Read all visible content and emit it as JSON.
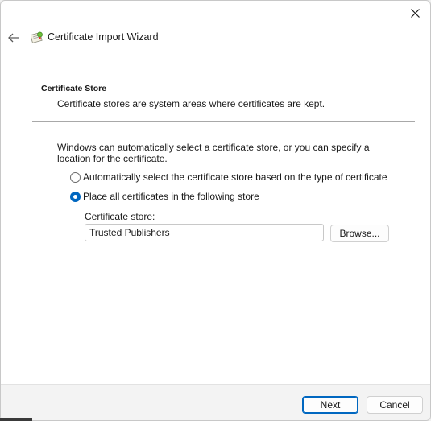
{
  "window": {
    "title": "Certificate Import Wizard",
    "icons": {
      "close": "close-icon",
      "back": "back-arrow-icon",
      "app": "certificate-icon"
    }
  },
  "page": {
    "section_title": "Certificate Store",
    "section_description": "Certificate stores are system areas where certificates are kept.",
    "intro_text": "Windows can automatically select a certificate store, or you can specify a location for the certificate."
  },
  "options": {
    "auto_select": {
      "label": "Automatically select the certificate store based on the type of certificate",
      "checked": false
    },
    "place_all": {
      "label": "Place all certificates in the following store",
      "checked": true
    }
  },
  "store": {
    "label": "Certificate store:",
    "value": "Trusted Publishers",
    "browse_label": "Browse..."
  },
  "footer": {
    "next_label": "Next",
    "cancel_label": "Cancel"
  },
  "colors": {
    "accent": "#0067c0",
    "footer_bg": "#f3f3f3",
    "divider": "#a8a8a8"
  }
}
